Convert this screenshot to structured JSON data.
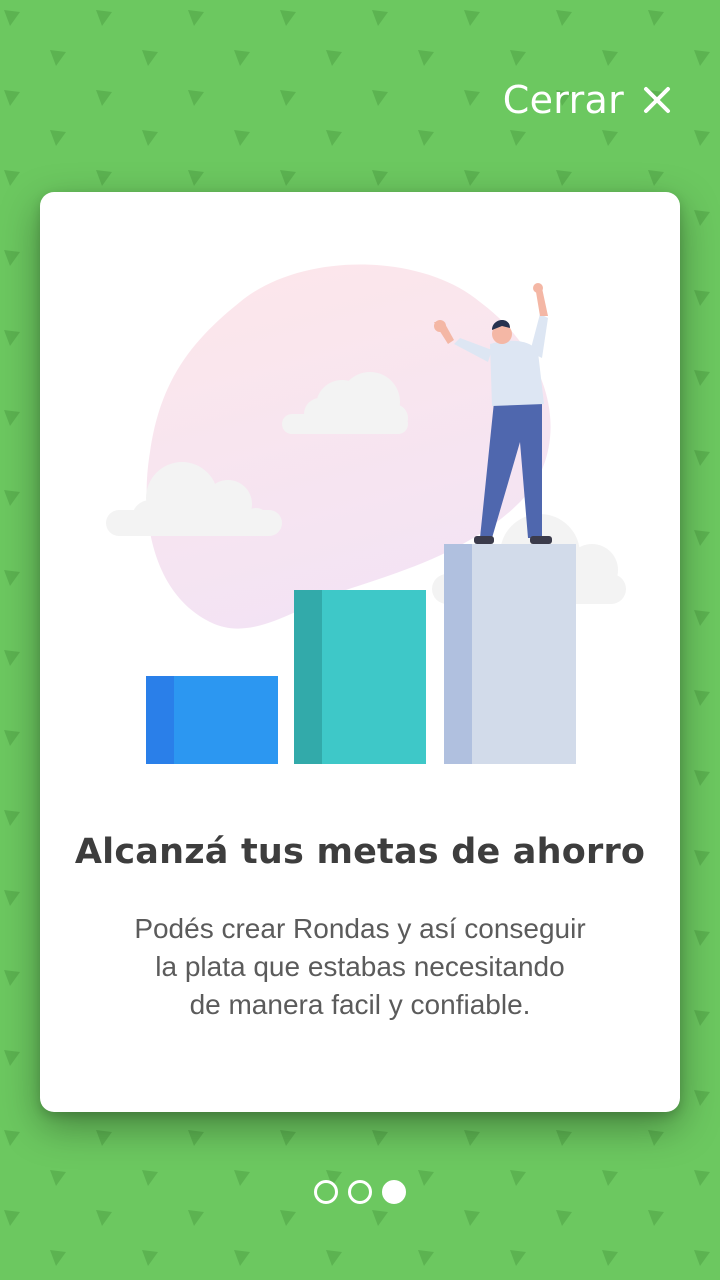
{
  "colors": {
    "background": "#6cc860",
    "pattern": "#5cb351",
    "card": "#ffffff",
    "title": "#3d3d3d",
    "description": "#5b5b5b"
  },
  "header": {
    "close_label": "Cerrar",
    "close_icon": "close-icon"
  },
  "card": {
    "title": "Alcanzá tus metas de ahorro",
    "description_lines": [
      "Podés crear Rondas y así conseguir",
      "la plata que estabas necesitando",
      "de manera facil y confiable."
    ],
    "illustration": "person-on-top-of-bar-chart-illustration"
  },
  "pagination": {
    "total": 3,
    "current": 3
  }
}
